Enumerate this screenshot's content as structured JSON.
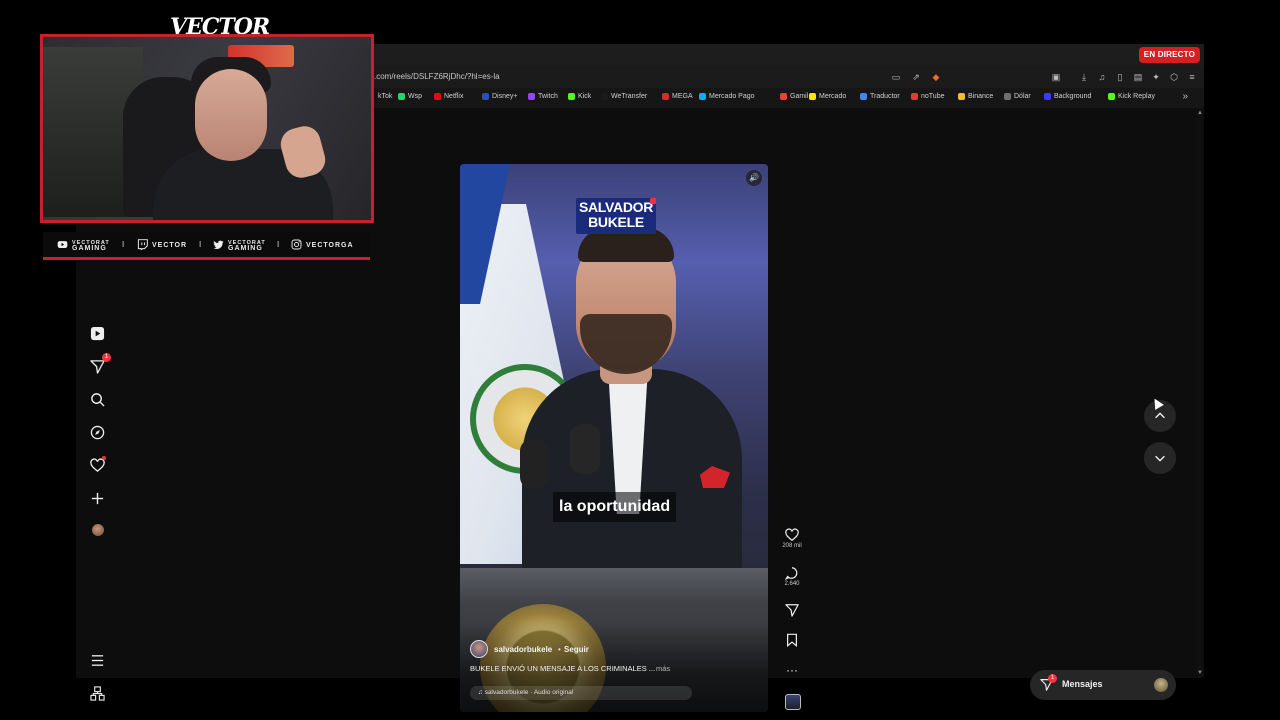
{
  "overlay": {
    "streamer_title": "VECTOR",
    "socials": [
      {
        "icon": "youtube-icon",
        "line1": "VECTORAT",
        "line2": "GAMING"
      },
      {
        "icon": "twitch-icon",
        "line1": "",
        "line2": "VECTOR"
      },
      {
        "icon": "twitter-icon",
        "line1": "VECTORAT",
        "line2": "GAMING"
      },
      {
        "icon": "instagram-icon",
        "line1": "",
        "line2": "VECTORGA"
      }
    ],
    "separator": "I"
  },
  "browser": {
    "live_badge": "EN DIRECTO",
    "url": ".com/reels/DSLFZ6RjDhc/?hl=es-la",
    "bookmarks": [
      {
        "label": "kTok",
        "color": "#111111"
      },
      {
        "label": "Wsp",
        "color": "#25d366"
      },
      {
        "label": "Netflix",
        "color": "#e50914"
      },
      {
        "label": "Disney+",
        "color": "#2a4dbf"
      },
      {
        "label": "Twitch",
        "color": "#9146ff"
      },
      {
        "label": "Kick",
        "color": "#53fc18"
      },
      {
        "label": "WeTransfer",
        "color": "#1a1a1a"
      },
      {
        "label": "MEGA",
        "color": "#d9272e"
      },
      {
        "label": "Mercado Pago",
        "color": "#00b1ea"
      },
      {
        "label": "Gamil",
        "color": "#ea4335"
      },
      {
        "label": "Mercado",
        "color": "#ffe600"
      },
      {
        "label": "Traductor",
        "color": "#4285f4"
      },
      {
        "label": "noTube",
        "color": "#e53935"
      },
      {
        "label": "Binance",
        "color": "#f3ba2f"
      },
      {
        "label": "Dólar",
        "color": "#6f6f6f"
      },
      {
        "label": "Background",
        "color": "#3b3bff"
      },
      {
        "label": "Kick Replay",
        "color": "#53fc18"
      }
    ],
    "bookmarks_more": "»"
  },
  "nav": {
    "direct_badge": "1",
    "items": [
      "reels-icon",
      "direct-icon",
      "search-icon",
      "explore-icon",
      "notifications-icon",
      "create-icon",
      "profile-avatar"
    ],
    "bottom": [
      "more-menu-icon",
      "also-from-meta-icon"
    ]
  },
  "reel": {
    "brand_text_1": "SALVADOR",
    "brand_text_2": "BUKELE",
    "caption_overlay": "la oportunidad",
    "author": "salvadorbukele",
    "follow_separator": "•",
    "follow": "Seguir",
    "caption": "BUKELE ENVIÓ UN MENSAJE A LOS CRIMINALES ...",
    "more": "más",
    "audio": "salvadorbukele · Audio original"
  },
  "actions": {
    "likes": "208 mil",
    "comments": "2.640"
  },
  "messages": {
    "label": "Mensajes",
    "badge": "1"
  }
}
